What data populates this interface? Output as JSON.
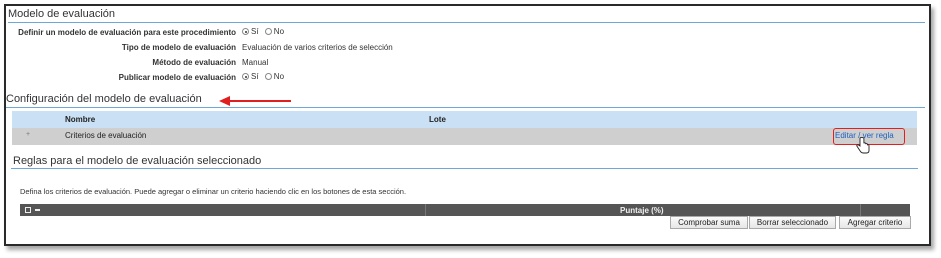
{
  "modelo": {
    "title": "Modelo de evaluación",
    "fields": [
      {
        "label": "Definir un modelo de evaluación para este procedimiento",
        "options": [
          "Sí",
          "No"
        ],
        "selected": "Sí"
      },
      {
        "label": "Tipo de modelo de evaluación",
        "value": "Evaluación de varios criterios de selección"
      },
      {
        "label": "Método de evaluación",
        "value": "Manual"
      },
      {
        "label": "Publicar modelo de evaluación",
        "options": [
          "Sí",
          "No"
        ],
        "selected": "Sí"
      }
    ]
  },
  "configuracion": {
    "title": "Configuración del modelo de evaluación",
    "columns": [
      "Nombre",
      "Lote"
    ],
    "row": {
      "expander": "+",
      "nombre": "Criterios de evaluación",
      "lote": "",
      "action": "Editar / ver regla"
    }
  },
  "reglas": {
    "title": "Reglas para el modelo de evaluación seleccionado",
    "instructions": "Defina los criterios de evaluación. Puede agregar o eliminar un criterio haciendo clic en los botones de esta sección.",
    "columns": [
      "Puntaje (%)"
    ],
    "buttons": {
      "check": "Comprobar suma",
      "delete": "Borrar seleccionado",
      "add": "Agregar criterio"
    }
  },
  "annotation_colors": {
    "arrow": "#e02020",
    "highlight": "#e02020"
  }
}
